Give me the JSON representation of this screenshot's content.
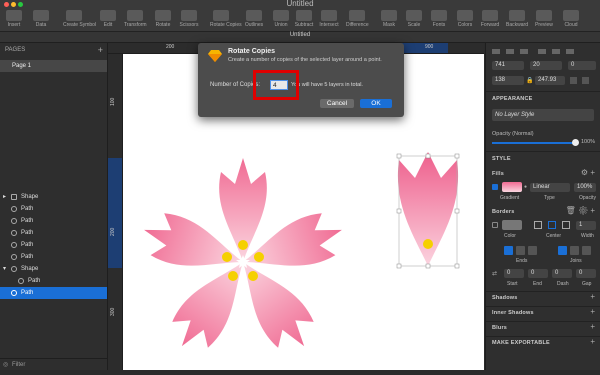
{
  "window": {
    "title": "Untitled"
  },
  "toolbar": {
    "items": [
      "Insert",
      "Data",
      "Create Symbol",
      "Edit",
      "Transform",
      "Rotate",
      "Scissors",
      "Rotate Copies",
      "Outlines",
      "Union",
      "Subtract",
      "Intersect",
      "Difference",
      "Mask",
      "Scale",
      "Fonts",
      "Colors",
      "Forward",
      "Backward",
      "Preview",
      "Cloud"
    ]
  },
  "tab": {
    "title": "Untitled"
  },
  "pages": {
    "heading": "PAGES",
    "add": "+",
    "items": [
      "Page 1"
    ]
  },
  "layers": [
    {
      "label": "Shape",
      "selected": false
    },
    {
      "label": "Path",
      "selected": false
    },
    {
      "label": "Path",
      "selected": false
    },
    {
      "label": "Path",
      "selected": false
    },
    {
      "label": "Path",
      "selected": false
    },
    {
      "label": "Path",
      "selected": false
    },
    {
      "label": "Shape",
      "selected": false
    },
    {
      "label": "Path",
      "selected": false
    },
    {
      "label": "Path",
      "selected": true
    }
  ],
  "filter": {
    "label": "Filter"
  },
  "ruler": {
    "h_start": "200",
    "h_end": "900",
    "v_labels": [
      "100",
      "200",
      "300"
    ]
  },
  "dialog": {
    "title": "Rotate Copies",
    "description": "Create a number of copies of the selected layer around a point.",
    "field_label": "Number of Copies:",
    "field_value": "4",
    "after_text": "You will have 5 layers in total.",
    "cancel": "Cancel",
    "ok": "OK"
  },
  "inspector": {
    "x": "741",
    "y": "20",
    "rotation": "0",
    "w": "138",
    "h": "247.93",
    "appearance": "APPEARANCE",
    "layer_style": "No Layer Style",
    "opacity_label": "Opacity (Normal)",
    "opacity_value": "100%",
    "style": "STYLE",
    "fills": "Fills",
    "fill_type": "Linear",
    "fill_opacity": "100%",
    "fill_labels": [
      "Gradient",
      "Type",
      "Opacity"
    ],
    "borders": "Borders",
    "border_width": "1",
    "border_labels": [
      "Color",
      "Center",
      "Width"
    ],
    "ends_label": "Ends",
    "joins_label": "Joins",
    "dash_values": [
      "0",
      "0",
      "0",
      "0"
    ],
    "dash_labels": [
      "Start",
      "End",
      "Dash",
      "Gap"
    ],
    "shadows": "Shadows",
    "inner_shadows": "Inner Shadows",
    "blurs": "Blurs",
    "make_exportable": "MAKE EXPORTABLE",
    "accent": "#1a6fd6"
  },
  "colors": {
    "flower": "#f06b93",
    "center_dot": "#f5d000",
    "highlight": "#e00000"
  }
}
